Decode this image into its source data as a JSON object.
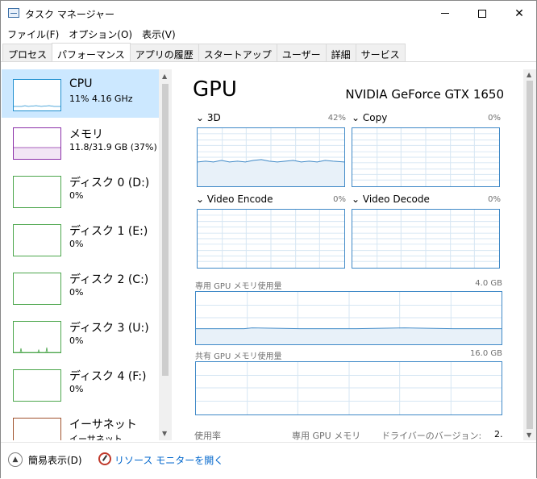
{
  "window": {
    "title": "タスク マネージャー"
  },
  "menu": [
    "ファイル(F)",
    "オプション(O)",
    "表示(V)"
  ],
  "tabs": [
    {
      "label": "プロセス",
      "active": false
    },
    {
      "label": "パフォーマンス",
      "active": true
    },
    {
      "label": "アプリの履歴",
      "active": false
    },
    {
      "label": "スタートアップ",
      "active": false
    },
    {
      "label": "ユーザー",
      "active": false
    },
    {
      "label": "詳細",
      "active": false
    },
    {
      "label": "サービス",
      "active": false
    }
  ],
  "sidebar": {
    "items": [
      {
        "name": "CPU",
        "sub": "11%  4.16 GHz",
        "color": "#1e8fd0",
        "selected": true
      },
      {
        "name": "メモリ",
        "sub": "11.8/31.9 GB (37%)",
        "color": "#8b2fa8",
        "selected": false
      },
      {
        "name": "ディスク 0 (D:)",
        "sub": "0%",
        "color": "#4ca64c",
        "selected": false
      },
      {
        "name": "ディスク 1 (E:)",
        "sub": "0%",
        "color": "#4ca64c",
        "selected": false
      },
      {
        "name": "ディスク 2 (C:)",
        "sub": "0%",
        "color": "#4ca64c",
        "selected": false
      },
      {
        "name": "ディスク 3 (U:)",
        "sub": "0%",
        "color": "#4ca64c",
        "selected": false
      },
      {
        "name": "ディスク 4 (F:)",
        "sub": "0%",
        "color": "#4ca64c",
        "selected": false
      },
      {
        "name": "イーサネット",
        "sub": "イーサネット",
        "color": "#a0522d",
        "selected": false
      }
    ]
  },
  "gpu": {
    "title": "GPU",
    "name": "NVIDIA GeForce GTX 1650",
    "engines": [
      {
        "label": "3D",
        "value": "42%"
      },
      {
        "label": "Copy",
        "value": "0%"
      },
      {
        "label": "Video Encode",
        "value": "0%"
      },
      {
        "label": "Video Decode",
        "value": "0%"
      }
    ],
    "dedicated": {
      "label": "専用 GPU メモリ使用量",
      "max": "4.0 GB"
    },
    "shared": {
      "label": "共有 GPU メモリ使用量",
      "max": "16.0 GB"
    },
    "stats": {
      "usage": "使用率",
      "dedicated_mem": "専用 GPU メモリ",
      "driver": "ドライバーのバージョン:",
      "driver_value": "2."
    }
  },
  "footer": {
    "fewer": "簡易表示(D)",
    "monitor": "リソース モニターを開く"
  },
  "colors": {
    "accent": "#3f89c7",
    "selected": "#cce8ff"
  }
}
